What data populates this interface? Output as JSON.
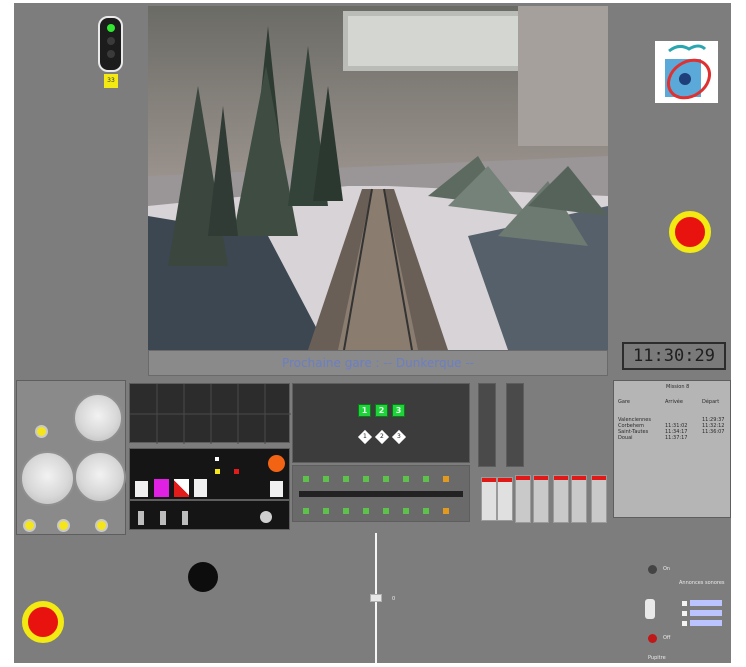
{
  "next_station": {
    "label": "Prochaine gare : -- Dunkerque --"
  },
  "clock": {
    "time": "11:30:29"
  },
  "signal": {
    "plate": "33"
  },
  "speed_indicators": [
    "1",
    "2",
    "3"
  ],
  "aux_indicators": [
    "1",
    "2",
    "3"
  ],
  "mission": {
    "title": "Mission 8",
    "headers": [
      "Gare",
      "Arrivée",
      "Départ"
    ],
    "rows": [
      {
        "gare": "Valenciennes",
        "arrivee": "",
        "depart": "11:29:37"
      },
      {
        "gare": "Corbehem",
        "arrivee": "11:31:02",
        "depart": "11:32:12"
      },
      {
        "gare": "Saint-Tautes",
        "arrivee": "11:34:17",
        "depart": "11:36:07"
      },
      {
        "gare": "Douai",
        "arrivee": "11:37:17",
        "depart": ""
      }
    ]
  },
  "controls": {
    "on_label": "On",
    "off_label": "Off",
    "pupitre_label": "Pupitre",
    "slider_label": "0",
    "options_title": "Annonces sonores",
    "panto_label": "Panto"
  },
  "colors": {
    "accent": "#f2ea12",
    "stop": "#e8120e",
    "led": "#1fd43a",
    "banner_text": "#6b7fc4"
  }
}
